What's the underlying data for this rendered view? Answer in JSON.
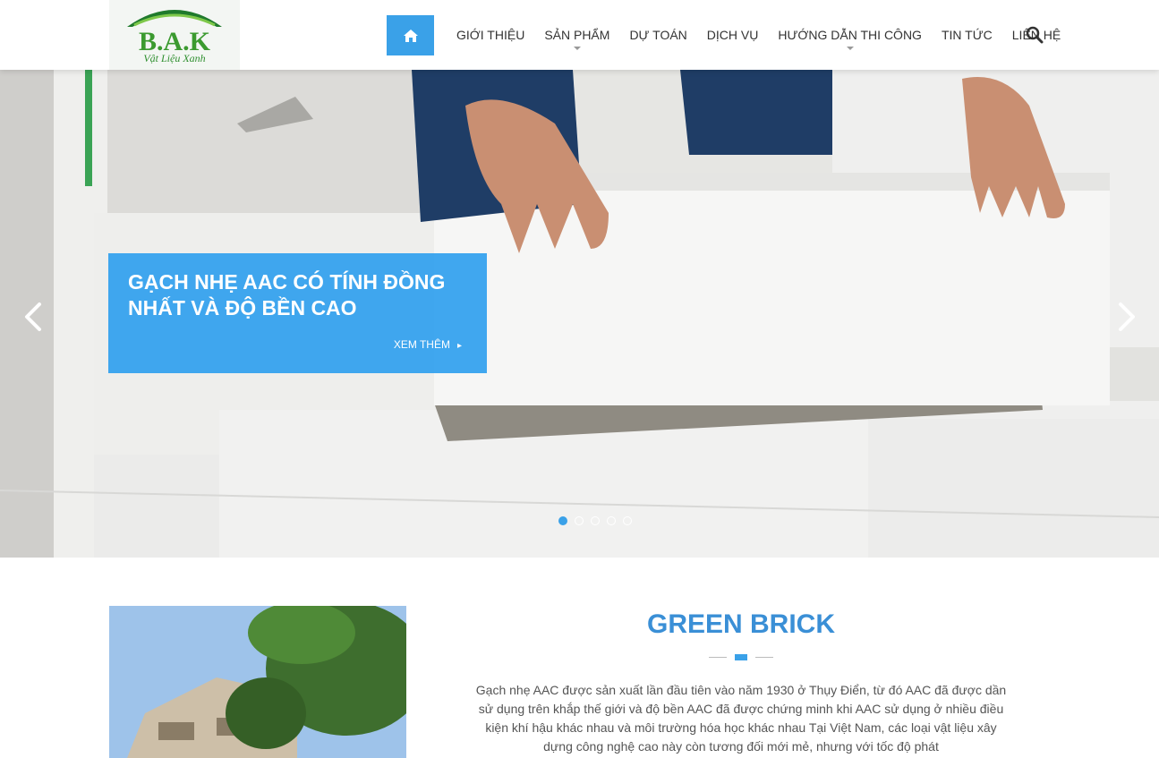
{
  "header": {
    "logo_text": "B.A.K",
    "logo_subtitle": "Vật Liệu Xanh",
    "nav_items": [
      {
        "label": "GIỚI THIỆU"
      },
      {
        "label": "SẢN PHẨM"
      },
      {
        "label": "DỰ TOÁN"
      },
      {
        "label": "DỊCH VỤ"
      },
      {
        "label": "HƯỚNG DẪN THI CÔNG"
      },
      {
        "label": "TIN TỨC"
      },
      {
        "label": "LIÊN HỆ"
      }
    ],
    "home_icon": "home-icon",
    "search_icon": "search-icon"
  },
  "hero": {
    "caption_title": "GẠCH NHẸ AAC CÓ TÍNH ĐỒNG NHẤT VÀ ĐỘ BỀN CAO",
    "caption_more": "XEM THÊM",
    "slide_count": 5,
    "active_slide": 1,
    "prev_icon": "chevron-left-icon",
    "next_icon": "chevron-right-icon"
  },
  "content": {
    "section_title": "GREEN BRICK",
    "intro_text": "Gạch nhẹ AAC được sản xuất lần đầu tiên vào năm 1930 ở Thụy Điển, từ đó AAC đã được dần sử dụng trên khắp thế giới và độ bền AAC đã được chứng minh khi AAC sử dụng ở nhiều điều kiện khí hậu khác nhau và môi trường hóa học khác nhau Tại Việt Nam, các loại vật liệu xây dựng công nghệ cao này còn tương đối mới mẻ, nhưng với tốc độ phát"
  },
  "colors": {
    "accent": "#3aa1e8",
    "title": "#3a8fd6",
    "logo_green": "#2f8f2f"
  }
}
